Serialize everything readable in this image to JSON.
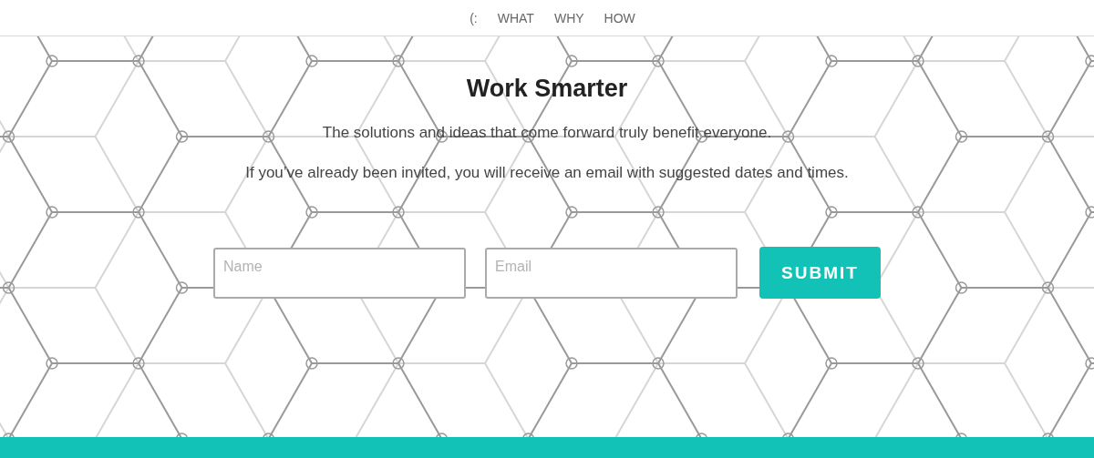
{
  "nav": {
    "items": [
      {
        "label": "(:"
      },
      {
        "label": "WHAT"
      },
      {
        "label": "WHY"
      },
      {
        "label": "HOW"
      }
    ]
  },
  "hero": {
    "title": "Work Smarter",
    "paragraphs": [
      "The solutions and ideas that come forward truly benefit everyone.",
      "If you’ve already been invited, you will receive an email with suggested dates and times."
    ],
    "form": {
      "fields": [
        {
          "placeholder": "Name"
        },
        {
          "placeholder": "Email"
        }
      ],
      "submit": "SUBMIT"
    }
  }
}
